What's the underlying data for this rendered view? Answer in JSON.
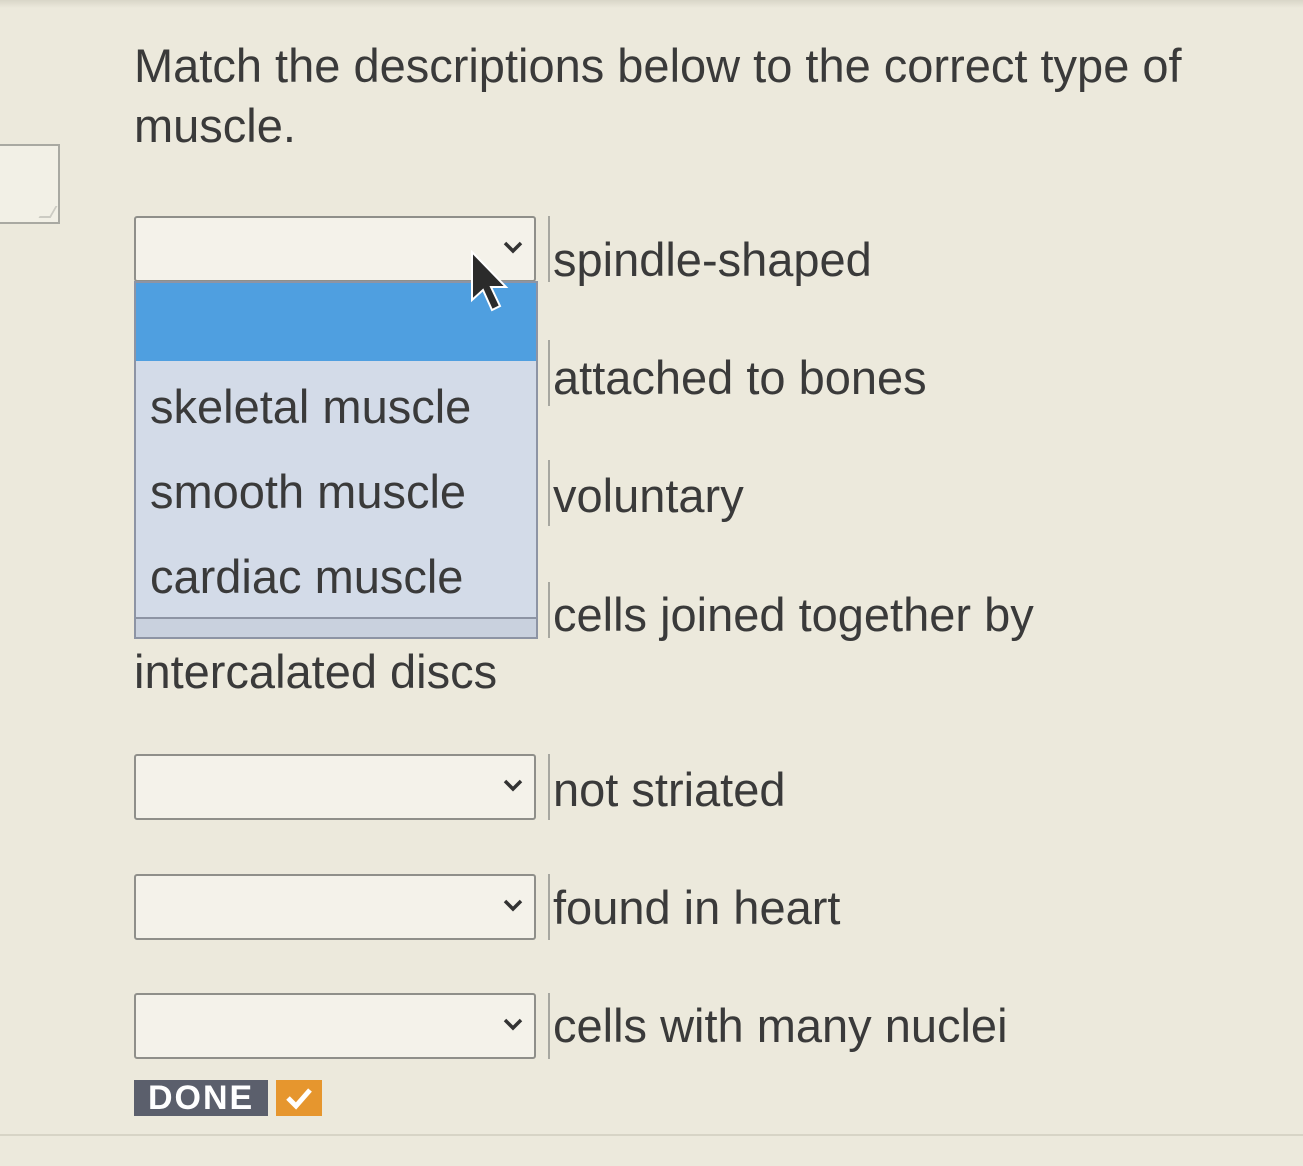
{
  "question": {
    "prompt": "Match the descriptions below to the correct type of muscle."
  },
  "rows": [
    {
      "description": "spindle-shaped",
      "selected": ""
    },
    {
      "description": "attached to bones",
      "selected": ""
    },
    {
      "description": "voluntary",
      "selected": ""
    },
    {
      "description": "cells joined together by intercalated discs",
      "description_line1": "cells joined together by",
      "description_line2": "intercalated discs",
      "selected": ""
    },
    {
      "description": "not striated",
      "selected": ""
    },
    {
      "description": "found in heart",
      "selected": ""
    },
    {
      "description": "cells with many nuclei",
      "selected": ""
    }
  ],
  "dropdown": {
    "open": true,
    "highlighted_option": "",
    "options": [
      "skeletal muscle",
      "smooth muscle",
      "cardiac muscle"
    ]
  },
  "done_button": {
    "label": "DONE"
  },
  "colors": {
    "highlight": "#4f9fe0",
    "done_bg": "#5b5f6c",
    "done_check": "#e6962e"
  },
  "icons": {
    "select_indicator": "chevron-down-icon",
    "done_indicator": "checkmark-icon",
    "pointer": "mouse-cursor-icon"
  }
}
